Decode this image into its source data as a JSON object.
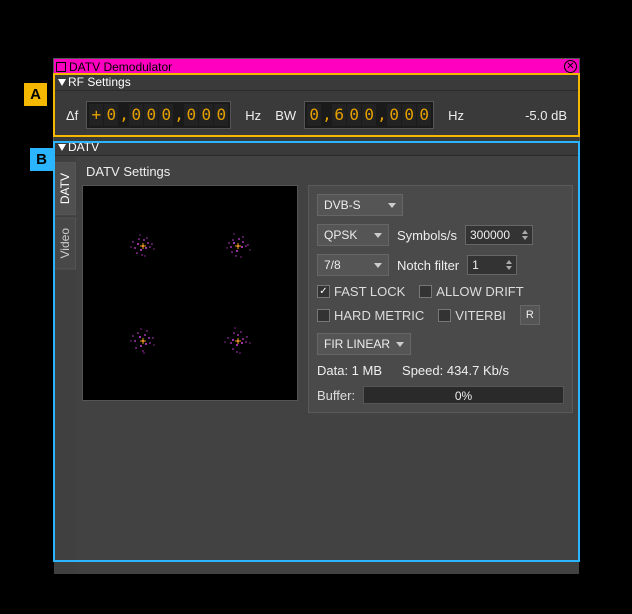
{
  "window": {
    "title": "DATV Demodulator"
  },
  "rf": {
    "header": "RF Settings",
    "df_label": "Δf",
    "df_sign": "+",
    "df_digits": [
      "0",
      "0",
      "0",
      "0",
      "0",
      "0",
      "0"
    ],
    "df_unit": "Hz",
    "bw_label": "BW",
    "bw_digits": [
      "0",
      "6",
      "0",
      "0",
      "0",
      "0",
      "0"
    ],
    "bw_unit": "Hz",
    "level": "-5.0 dB"
  },
  "datv": {
    "header": "DATV",
    "tab_datv": "DATV",
    "tab_video": "Video",
    "settings_title": "DATV Settings",
    "standard": "DVB-S",
    "modulation": "QPSK",
    "symbols_label": "Symbols/s",
    "symbols_value": "300000",
    "fec": "7/8",
    "notch_label": "Notch filter",
    "notch_value": "1",
    "fastlock": "FAST LOCK",
    "allowdrift": "ALLOW DRIFT",
    "hardmetric": "HARD METRIC",
    "viterbi": "VITERBI",
    "reset": "R",
    "filter": "FIR LINEAR",
    "data_label": "Data: 1 MB",
    "speed_label": "Speed: 434.7 Kb/s",
    "buffer_label": "Buffer:",
    "buffer_pct": "0%"
  },
  "annotations": {
    "a": "A",
    "b": "B"
  }
}
